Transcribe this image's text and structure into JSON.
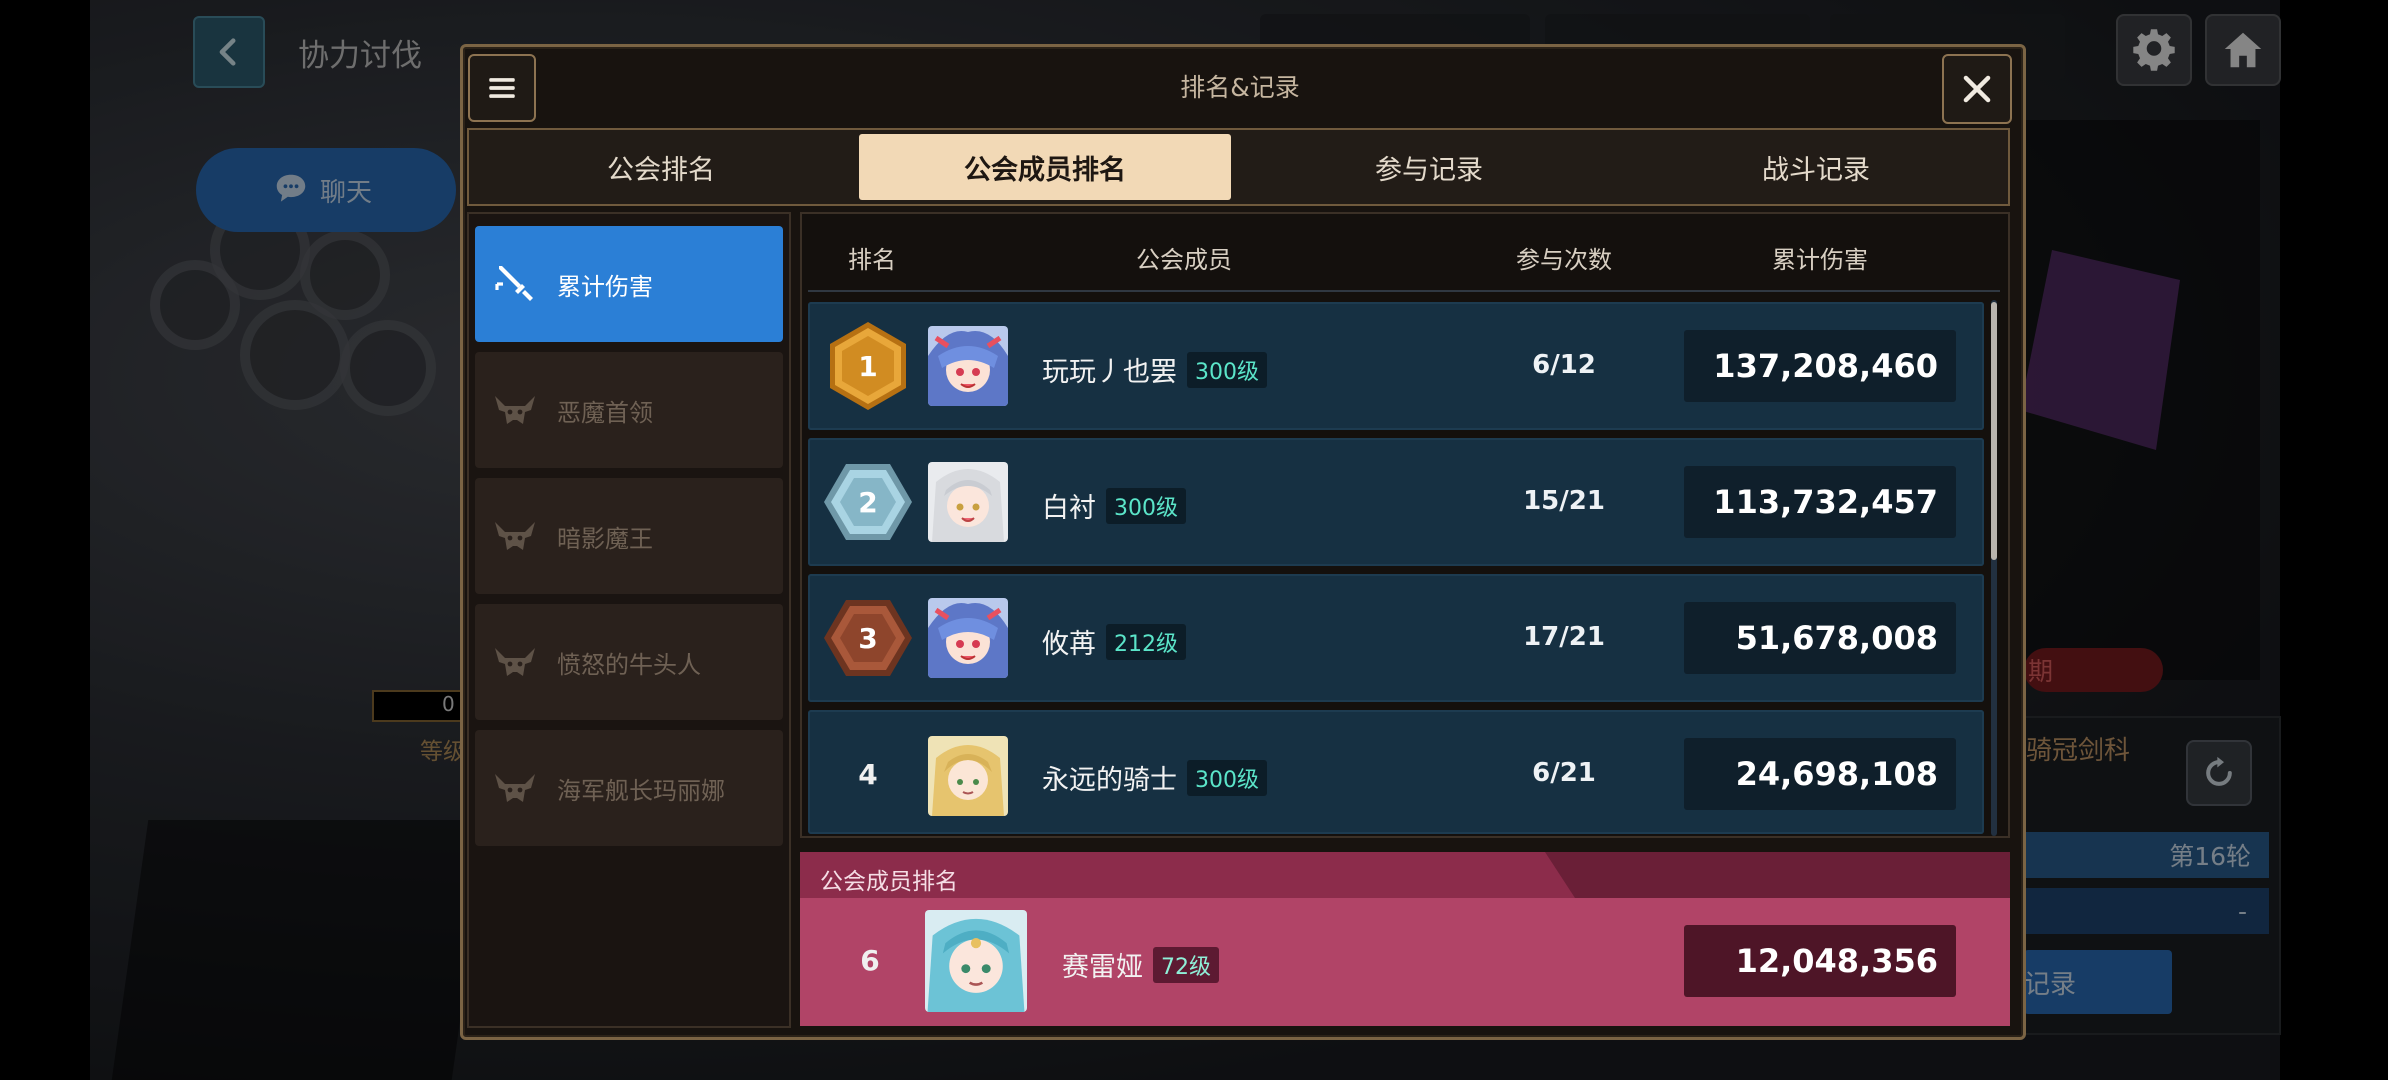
{
  "header": {
    "page_title": "协力讨伐",
    "chat_label": "聊天"
  },
  "background": {
    "left_counter": "0",
    "left_label": "等级",
    "banner_text": "期",
    "panel_name": "骑冠剑科",
    "round_label": "第16轮",
    "round_value": "-",
    "record_button": "记录"
  },
  "modal": {
    "title": "排名&记录",
    "tabs": [
      {
        "label": "公会排名",
        "active": false
      },
      {
        "label": "公会成员排名",
        "active": true
      },
      {
        "label": "参与记录",
        "active": false
      },
      {
        "label": "战斗记录",
        "active": false
      }
    ],
    "categories": [
      {
        "label": "累计伤害",
        "icon": "sword-icon",
        "active": true
      },
      {
        "label": "恶魔首领",
        "icon": "demon-skull-icon",
        "active": false
      },
      {
        "label": "暗影魔王",
        "icon": "demon-skull-icon",
        "active": false
      },
      {
        "label": "愤怒的牛头人",
        "icon": "demon-skull-icon",
        "active": false
      },
      {
        "label": "海军舰长玛丽娜",
        "icon": "demon-skull-icon",
        "active": false
      }
    ],
    "columns": {
      "rank": "排名",
      "member": "公会成员",
      "participation": "参与次数",
      "damage": "累计伤害"
    },
    "rows": [
      {
        "rank": "1",
        "medal": "gold",
        "name": "玩玩丿也罢",
        "level": "300级",
        "count": "6/12",
        "damage": "137,208,460"
      },
      {
        "rank": "2",
        "medal": "silver",
        "name": "白衬",
        "level": "300级",
        "count": "15/21",
        "damage": "113,732,457"
      },
      {
        "rank": "3",
        "medal": "bronze",
        "name": "攸苒",
        "level": "212级",
        "count": "17/21",
        "damage": "51,678,008"
      },
      {
        "rank": "4",
        "medal": "none",
        "name": "永远的骑士",
        "level": "300级",
        "count": "6/21",
        "damage": "24,698,108"
      }
    ],
    "my_rank": {
      "header": "公会成员排名",
      "rank": "6",
      "name": "赛雷娅",
      "level": "72级",
      "damage": "12,048,356"
    }
  },
  "colors": {
    "gold": "#e8a73a",
    "silver": "#a9d4e3",
    "bronze": "#a9583a",
    "active_tab": "#f2d9b6",
    "active_side": "#2b7fd6",
    "my_row": "#b14467"
  }
}
